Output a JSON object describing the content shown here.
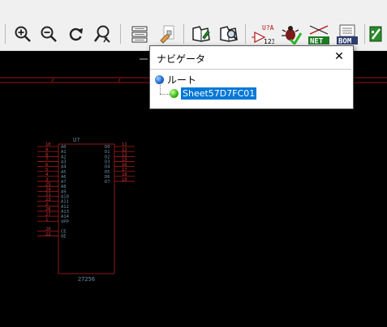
{
  "toolbar": {
    "buttons": [
      {
        "name": "zoom-in-icon"
      },
      {
        "name": "zoom-out-icon"
      },
      {
        "name": "redraw-icon"
      },
      {
        "name": "zoom-fit-icon"
      },
      {
        "name": "hierarchy-navigator-icon"
      },
      {
        "name": "leave-sheet-icon"
      },
      {
        "name": "edit-symbol-library-icon"
      },
      {
        "name": "browse-symbol-library-icon"
      },
      {
        "name": "annotate-icon",
        "label_top": "U?A",
        "label_bottom": "123"
      },
      {
        "name": "erc-check-icon"
      },
      {
        "name": "netlist-icon",
        "label": "NET"
      },
      {
        "name": "bom-icon",
        "label": "BOM"
      },
      {
        "name": "cvpcb-icon"
      }
    ]
  },
  "navigator": {
    "title": "ナビゲータ",
    "close_label": "✕",
    "root_label": "ルート",
    "child_label": "Sheet57D7FC01"
  },
  "schematic": {
    "ref": "U?",
    "value": "27256",
    "left_pins": [
      {
        "num": "10",
        "name": "A0"
      },
      {
        "num": "9",
        "name": "A1"
      },
      {
        "num": "8",
        "name": "A2"
      },
      {
        "num": "7",
        "name": "A3"
      },
      {
        "num": "6",
        "name": "A4"
      },
      {
        "num": "5",
        "name": "A5"
      },
      {
        "num": "4",
        "name": "A6"
      },
      {
        "num": "3",
        "name": "A7"
      },
      {
        "num": "25",
        "name": "A8"
      },
      {
        "num": "24",
        "name": "A9"
      },
      {
        "num": "21",
        "name": "A10"
      },
      {
        "num": "23",
        "name": "A11"
      },
      {
        "num": "2",
        "name": "A12"
      },
      {
        "num": "26",
        "name": "A13"
      },
      {
        "num": "27",
        "name": "A14"
      },
      {
        "num": "1",
        "name": "VPP"
      },
      {
        "num": "20",
        "name": "CE"
      },
      {
        "num": "22",
        "name": "OE"
      }
    ],
    "right_pins": [
      {
        "num": "11",
        "name": "D0"
      },
      {
        "num": "12",
        "name": "D1"
      },
      {
        "num": "13",
        "name": "D2"
      },
      {
        "num": "15",
        "name": "D3"
      },
      {
        "num": "16",
        "name": "D4"
      },
      {
        "num": "17",
        "name": "D5"
      },
      {
        "num": "18",
        "name": "D6"
      },
      {
        "num": "19",
        "name": "D7"
      }
    ]
  },
  "colors": {
    "wire": "#b01818",
    "pin_text": "#d23a3a",
    "body": "#8a1a1a",
    "label": "#6d8fa6"
  }
}
